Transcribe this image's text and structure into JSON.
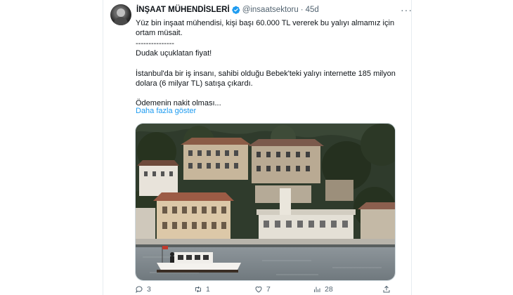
{
  "tweet": {
    "author_name": "İNŞAAT MÜHENDİSLERİ",
    "handle": "@insaatsektoru",
    "separator": "·",
    "time": "45d",
    "more_icon": "more-icon",
    "paragraphs": [
      "Yüz bin inşaat mühendisi, kişi başı 60.000 TL vererek bu yalıyı almamız için ortam müsait.\n---------------\nDudak uçuklatan fiyat!",
      "İstanbul'da bir iş insanı, sahibi olduğu Bebek'teki yalıyı internette 185 milyon dolara (6 milyar TL) satışa çıkardı.",
      "Ödemenin nakit olması..."
    ],
    "show_more": "Daha fazla göster",
    "accent_color": "#1d9bf0",
    "verified_color": "#1d9bf0"
  },
  "actions": {
    "replies": "3",
    "retweets": "1",
    "likes": "7",
    "views": "28"
  }
}
